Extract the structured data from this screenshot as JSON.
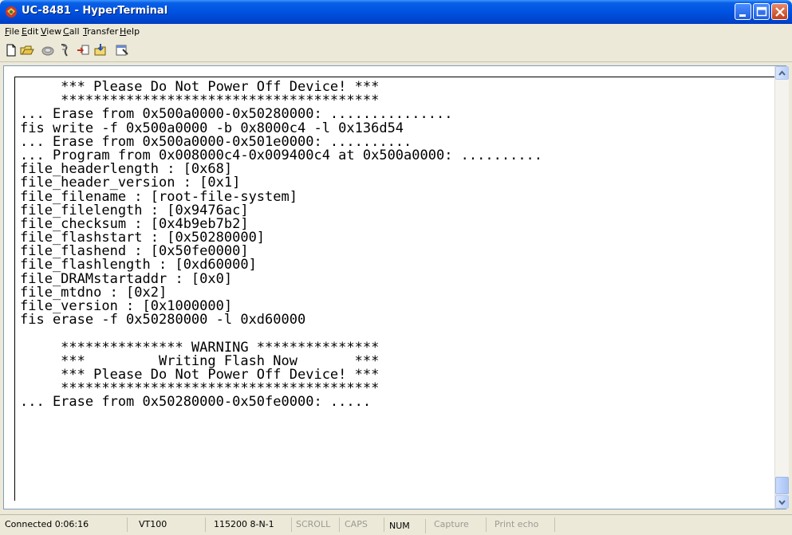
{
  "window": {
    "title": "UC-8481 - HyperTerminal"
  },
  "menu": [
    {
      "accel": "F",
      "rest": "ile"
    },
    {
      "accel": "E",
      "rest": "dit"
    },
    {
      "accel": "V",
      "rest": "iew"
    },
    {
      "accel": "C",
      "rest": "all"
    },
    {
      "accel": "T",
      "rest": "ransfer"
    },
    {
      "accel": "H",
      "rest": "elp"
    }
  ],
  "toolbar": {
    "icons": [
      "new-icon",
      "open-icon",
      "call-icon",
      "disconnect-icon",
      "send-icon",
      "receive-icon",
      "properties-icon"
    ]
  },
  "terminal": {
    "lines": [
      "     *** Please Do Not Power Off Device! ***",
      "     ***************************************",
      "... Erase from 0x500a0000-0x50280000: ...............",
      "fis write -f 0x500a0000 -b 0x8000c4 -l 0x136d54",
      "... Erase from 0x500a0000-0x501e0000: ..........",
      "... Program from 0x008000c4-0x009400c4 at 0x500a0000: ..........",
      "file_headerlength : [0x68]",
      "file_header_version : [0x1]",
      "file_filename : [root-file-system]",
      "file_filelength : [0x9476ac]",
      "file_checksum : [0x4b9eb7b2]",
      "file_flashstart : [0x50280000]",
      "file_flashend : [0x50fe0000]",
      "file_flashlength : [0xd60000]",
      "file_DRAMstartaddr : [0x0]",
      "file_mtdno : [0x2]",
      "file_version : [0x1000000]",
      "fis erase -f 0x50280000 -l 0xd60000",
      "",
      "     *************** WARNING ***************",
      "     ***         Writing Flash Now       ***",
      "     *** Please Do Not Power Off Device! ***",
      "     ***************************************",
      "... Erase from 0x50280000-0x50fe0000: ....."
    ]
  },
  "status": {
    "connected": "Connected 0:06:16",
    "emulation": "VT100",
    "port": "115200 8-N-1",
    "scroll": "SCROLL",
    "caps": "CAPS",
    "num": "NUM",
    "capture": "Capture",
    "print_echo": "Print echo"
  },
  "colors": {
    "title_bar": "#0054e3",
    "chrome": "#ece9d8",
    "terminal_bg": "#ffffff",
    "terminal_fg": "#000000"
  }
}
